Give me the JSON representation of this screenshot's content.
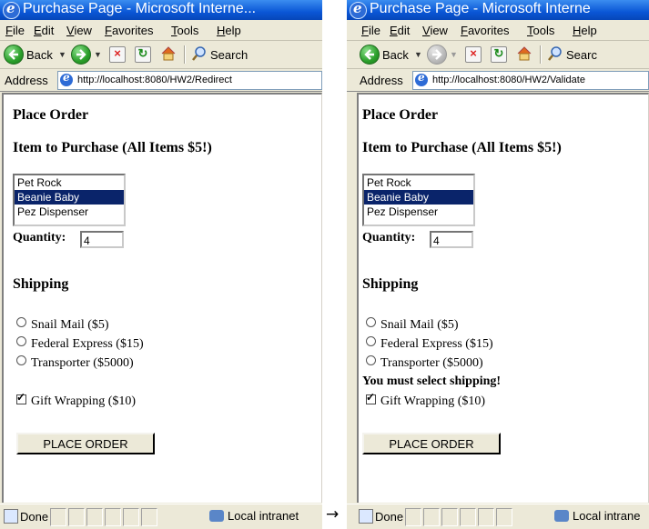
{
  "arrow": "→",
  "windows": [
    {
      "title": "Purchase Page - Microsoft Interne...",
      "menu": [
        "File",
        "Edit",
        "View",
        "Favorites",
        "Tools",
        "Help"
      ],
      "toolbar": {
        "back_label": "Back",
        "search_label": "Search"
      },
      "address": {
        "label": "Address",
        "url": "http://localhost:8080/HW2/Redirect"
      },
      "page": {
        "heading1": "Place Order",
        "heading2": "Item to Purchase (All Items $5!)",
        "items": [
          "Pet Rock",
          "Beanie Baby",
          "Pez Dispenser"
        ],
        "selected_item": "Beanie Baby",
        "quantity_label": "Quantity:",
        "quantity_value": "4",
        "shipping_heading": "Shipping",
        "shipping_options": [
          "Snail Mail ($5)",
          "Federal Express ($15)",
          "Transporter ($5000)"
        ],
        "error": "",
        "gift_label": "Gift Wrapping ($10)",
        "gift_checked": true,
        "button_label": "PLACE ORDER"
      },
      "status": {
        "text": "Done",
        "zone": "Local intranet"
      }
    },
    {
      "title": "Purchase Page - Microsoft Interne",
      "menu": [
        "File",
        "Edit",
        "View",
        "Favorites",
        "Tools",
        "Help"
      ],
      "toolbar": {
        "back_label": "Back",
        "search_label": "Searc"
      },
      "address": {
        "label": "Address",
        "url": "http://localhost:8080/HW2/Validate"
      },
      "page": {
        "heading1": "Place Order",
        "heading2": "Item to Purchase (All Items $5!)",
        "items": [
          "Pet Rock",
          "Beanie Baby",
          "Pez Dispenser"
        ],
        "selected_item": "Beanie Baby",
        "quantity_label": "Quantity:",
        "quantity_value": "4",
        "shipping_heading": "Shipping",
        "shipping_options": [
          "Snail Mail ($5)",
          "Federal Express ($15)",
          "Transporter ($5000)"
        ],
        "error": "You must select shipping!",
        "gift_label": "Gift Wrapping ($10)",
        "gift_checked": true,
        "button_label": "PLACE ORDER"
      },
      "status": {
        "text": "Done",
        "zone": "Local intrane"
      }
    }
  ]
}
